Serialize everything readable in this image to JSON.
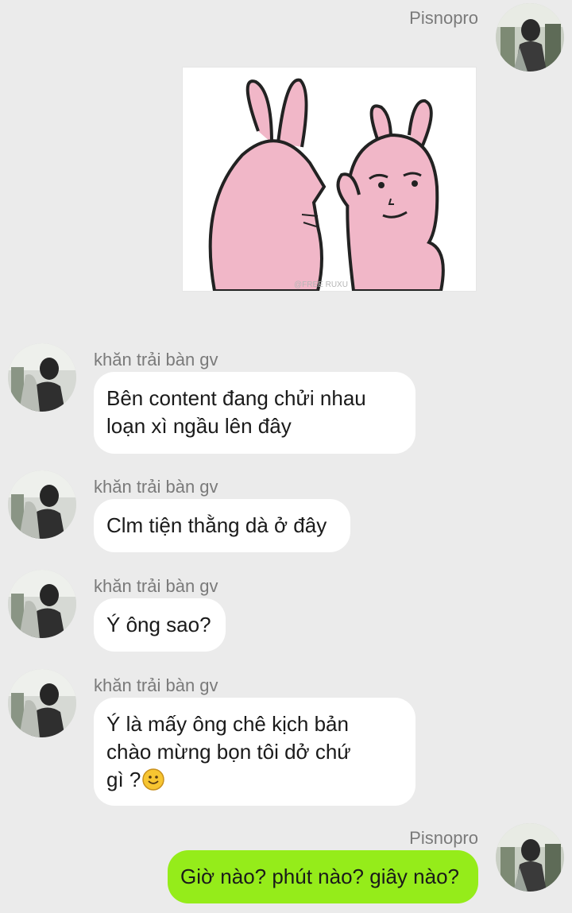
{
  "colors": {
    "background": "#ebebeb",
    "incoming_bubble": "#ffffff",
    "outgoing_bubble": "#95ec1a",
    "name_text": "#7a7a7a",
    "sticker_pink": "#f1b7c8"
  },
  "messages": [
    {
      "sender": "Pisnopro",
      "side": "right",
      "type": "sticker",
      "sticker_icon": "two-pink-rabbits-sticker",
      "sticker_watermark": "@FREE RUXU"
    },
    {
      "sender": "khăn trải bàn gv",
      "side": "left",
      "type": "text",
      "lines": [
        "Bên content đang chửi nhau",
        "loạn xì ngầu lên đây"
      ]
    },
    {
      "sender": "khăn trải bàn gv",
      "side": "left",
      "type": "text",
      "lines": [
        "Clm tiện thằng dà ở đây"
      ]
    },
    {
      "sender": "khăn trải bàn gv",
      "side": "left",
      "type": "text",
      "lines": [
        "Ý ông sao?"
      ]
    },
    {
      "sender": "khăn trải bàn gv",
      "side": "left",
      "type": "text",
      "lines": [
        "Ý là mấy ông chê kịch bản",
        "chào mừng bọn tôi dở chứ",
        "gì ?"
      ],
      "emoji": "smile-emoji"
    },
    {
      "sender": "Pisnopro",
      "side": "right",
      "type": "text",
      "lines": [
        "Giờ nào? phút nào? giây nào?"
      ]
    }
  ]
}
